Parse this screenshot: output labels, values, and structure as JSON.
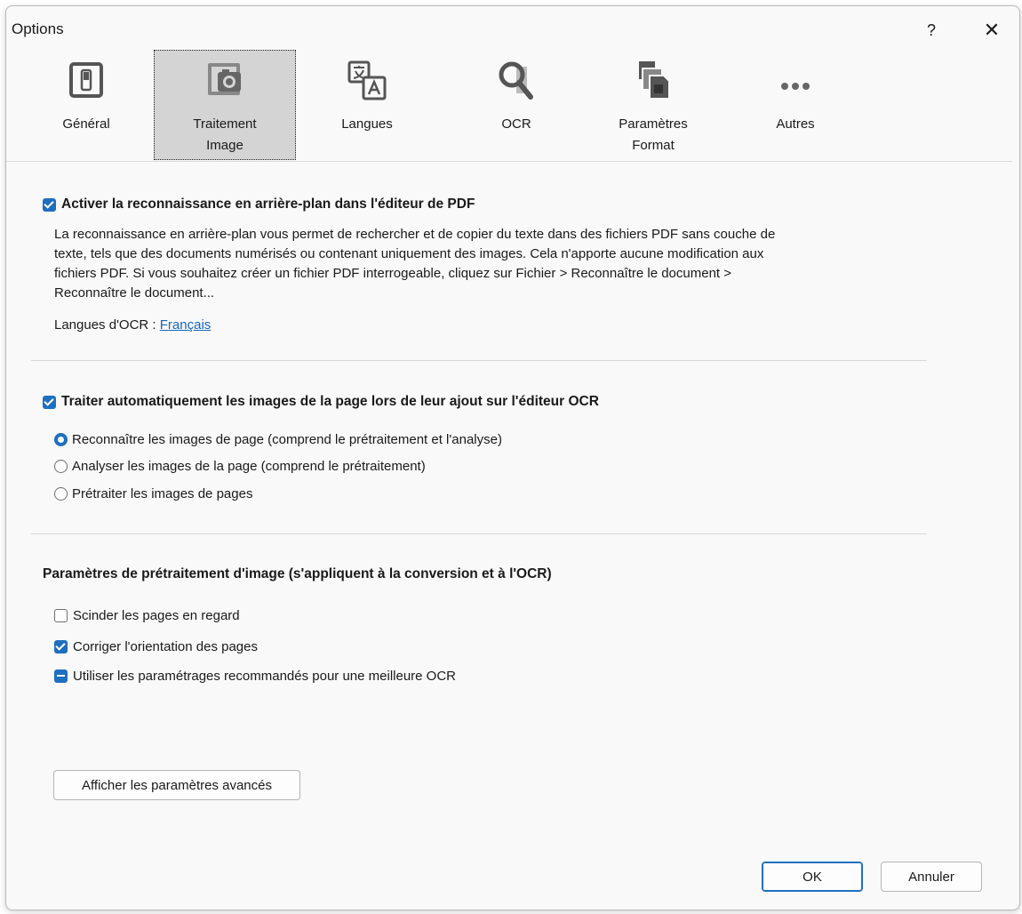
{
  "window": {
    "title": "Options",
    "help_label": "?",
    "close_label": "✕"
  },
  "toolbar": {
    "tabs": [
      {
        "label": "Général",
        "icon": "general-icon"
      },
      {
        "label": "Traitement\nImage",
        "icon": "image-processing-icon",
        "selected": true
      },
      {
        "label": "Langues",
        "icon": "languages-icon"
      },
      {
        "label": "OCR",
        "icon": "ocr-icon"
      },
      {
        "label": "Paramètres\nFormat",
        "icon": "format-settings-icon"
      },
      {
        "label": "Autres",
        "icon": "more-icon"
      }
    ]
  },
  "background": {
    "checkbox_label": "Activer la reconnaissance en arrière-plan dans l'éditeur de PDF",
    "checked": true,
    "description_lines": [
      "La reconnaissance en arrière-plan vous permet de rechercher et de copier du texte dans des fichiers PDF sans couche de",
      "texte, tels que des documents numérisés ou contenant uniquement des images. Cela n'apporte aucune modification aux",
      "fichiers PDF. Si vous souhaitez créer un fichier PDF interrogeable, cliquez sur Fichier > Reconnaître le document >",
      "Reconnaître le document..."
    ],
    "ocr_languages_label": "Langues d'OCR : ",
    "ocr_languages_link": "Français"
  },
  "auto_process": {
    "checkbox_label": "Traiter automatiquement les images de la page lors de leur ajout sur l'éditeur OCR",
    "checked": true,
    "options": [
      {
        "label": "Reconnaître les images de page (comprend le prétraitement et l'analyse)",
        "selected": true
      },
      {
        "label": "Analyser les images de la page (comprend le prétraitement)",
        "selected": false
      },
      {
        "label": "Prétraiter les images de pages",
        "selected": false
      }
    ]
  },
  "preprocessing": {
    "heading": "Paramètres de prétraitement d'image (s'appliquent à la conversion et à l'OCR)",
    "options": [
      {
        "label": "Scinder les pages en regard",
        "state": "off"
      },
      {
        "label": "Corriger l'orientation des pages",
        "state": "on"
      },
      {
        "label": "Utiliser les paramétrages recommandés pour une meilleure OCR",
        "state": "mixed"
      }
    ],
    "advanced_button": "Afficher les paramètres avancés"
  },
  "footer": {
    "ok_label": "OK",
    "cancel_label": "Annuler"
  },
  "colors": {
    "accent": "#1e6fbf",
    "link": "#1565c0",
    "selected_tab_bg": "#d4d4d4"
  }
}
